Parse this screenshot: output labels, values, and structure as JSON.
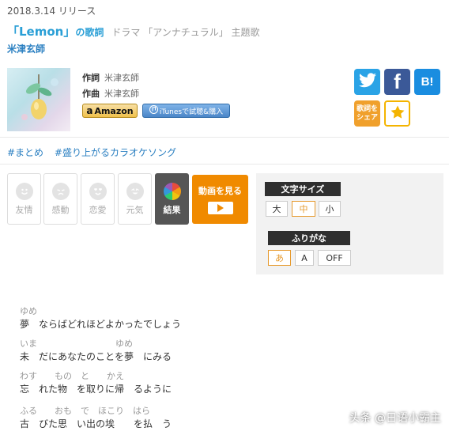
{
  "header": {
    "release": "2018.3.14 リリース",
    "song_title": "「Lemon」",
    "lyrics_label": "の歌詞",
    "drama": "ドラマ 「アンナチュラル」 主題歌",
    "artist": "米津玄師"
  },
  "credits": {
    "lyricist_label": "作詞",
    "lyricist": "米津玄師",
    "composer_label": "作曲",
    "composer": "米津玄師"
  },
  "store": {
    "amazon_icon": "a",
    "amazon_label": "Amazon",
    "itunes_label": "iTunesで試聴&購入"
  },
  "social": {
    "facebook_glyph": "f",
    "hatena_glyph": "B!",
    "share_line1": "歌詞を",
    "share_line2": "シェア",
    "fav_icon": "star-icon"
  },
  "tags": [
    "#まとめ",
    "#盛り上がるカラオケソング"
  ],
  "moods": [
    "友情",
    "感動",
    "恋愛",
    "元気"
  ],
  "result_label": "結果",
  "video_label": "動画を見る",
  "font_size": {
    "title": "文字サイズ",
    "options": [
      "大",
      "中",
      "小"
    ],
    "selected": "中"
  },
  "furigana": {
    "title": "ふりがな",
    "options": [
      "あ",
      "A",
      "OFF"
    ],
    "selected": "あ"
  },
  "lyrics": [
    {
      "ruby": "ゆめ",
      "text": "夢　ならばどれほどよかったでしょう"
    },
    {
      "ruby": "いま　　　　　　　　　ゆめ",
      "text": "未　だにあなたのことを夢　にみる"
    },
    {
      "ruby": "わす　　もの　と　　かえ",
      "text": "忘　れた物　を取りに帰　るように"
    },
    {
      "ruby": "ふる　　おも　で　ほこり　はら",
      "text": "古　びた思　い出の埃　　を払　う"
    }
  ],
  "watermark": "头条 @日语小霸主",
  "colors": {
    "accent_blue": "#2a9fd6",
    "orange": "#f08a00",
    "selected": "#e69a2e"
  }
}
